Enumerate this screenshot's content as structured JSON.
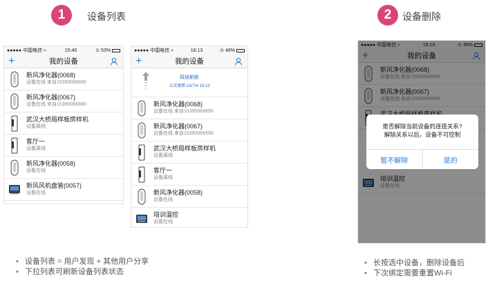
{
  "colors": {
    "accent": "#d9447a",
    "link_blue": "#2f7bd6"
  },
  "step1": {
    "number": "1",
    "title": "设备列表"
  },
  "step2": {
    "number": "2",
    "title": "设备删除"
  },
  "phone1": {
    "status": {
      "carrier": "●●●●● 中国电信 ",
      "time": "15:40",
      "battery": "53%"
    },
    "nav_title": "我的设备",
    "devices": [
      {
        "name": "新风净化器(0068)",
        "sub": "设备在线    来自15390066690",
        "icon": "purifier-icon"
      },
      {
        "name": "新风净化器(0067)",
        "sub": "设备在线    来自15390066690",
        "icon": "purifier-icon"
      },
      {
        "name": "武汉大桥局样板房样机",
        "sub": "设备离线",
        "icon": "tall-unit-icon"
      },
      {
        "name": "客厅一",
        "sub": "设备离线",
        "icon": "tall-unit-icon"
      },
      {
        "name": "新风净化器(0058)",
        "sub": "设备在线",
        "icon": "purifier-icon"
      },
      {
        "name": "新风风机盘管(0057)",
        "sub": "设备在线",
        "icon": "fan-coil-icon"
      }
    ]
  },
  "phone2": {
    "status": {
      "carrier": "●●●●● 中国电信 ",
      "time": "16:13",
      "battery": "48%"
    },
    "nav_title": "我的设备",
    "pull_text": "释放刷新",
    "pull_sub": "上次更新:16/7/4 16:13",
    "devices": [
      {
        "name": "新风净化器(0068)",
        "sub": "设备在线    来自15390066690",
        "icon": "purifier-icon"
      },
      {
        "name": "新风净化器(0067)",
        "sub": "设备在线    来自15390066690",
        "icon": "purifier-icon"
      },
      {
        "name": "武汉大桥局样板房样机",
        "sub": "设备离线",
        "icon": "tall-unit-icon"
      },
      {
        "name": "客厅一",
        "sub": "设备离线",
        "icon": "tall-unit-icon"
      },
      {
        "name": "新风净化器(0058)",
        "sub": "设备在线",
        "icon": "purifier-icon"
      },
      {
        "name": "培训温控",
        "sub": "设备在线",
        "icon": "thermostat-icon"
      }
    ]
  },
  "phone3": {
    "status": {
      "carrier": "●●●●● 中国电信 ",
      "time": "16:14",
      "battery": "48%"
    },
    "nav_title": "我的设备",
    "devices": [
      {
        "name": "新风净化器(0068)",
        "sub": "设备在线    来自15390066690",
        "icon": "purifier-icon"
      },
      {
        "name": "新风净化器(0067)",
        "sub": "设备在线    来自15390066690",
        "icon": "purifier-icon"
      },
      {
        "name": "武汉大桥局样板房样机",
        "sub": "设备离线",
        "icon": "tall-unit-icon"
      }
    ],
    "bottom_device": {
      "name": "培训温控",
      "sub": "设备在线",
      "icon": "thermostat-icon"
    },
    "dialog": {
      "line1": "是否解除当前设备的连接关系?",
      "line2": "解除关系以后，设备不可控制",
      "cancel": "暂不解除",
      "confirm": "是的"
    }
  },
  "notes_left": [
    "设备列表 = 用户发现 + 其他用户分享",
    "下拉列表可刷新设备列表状态"
  ],
  "notes_right": [
    "长按选中设备，删除设备后",
    "下次绑定需要重置Wi-Fi"
  ]
}
